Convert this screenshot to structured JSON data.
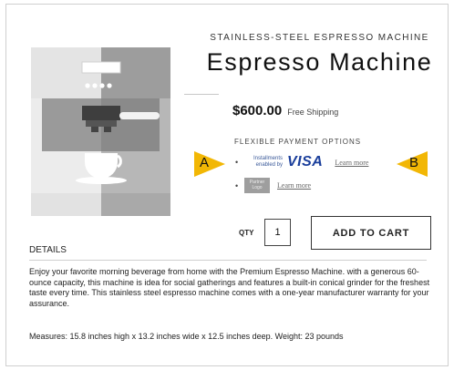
{
  "product": {
    "subtitle": "STAINLESS-STEEL ESPRESSO MACHINE",
    "title": "Espresso Machine",
    "price": "$600.00",
    "shipping": "Free Shipping"
  },
  "payment": {
    "heading": "FLEXIBLE PAYMENT OPTIONS",
    "installments_line1": "Installments",
    "installments_line2": "enabled by",
    "visa": "VISA",
    "learn_more_1": "Learn more",
    "partner_line1": "Partner",
    "partner_line2": "Logo",
    "learn_more_2": "Learn more"
  },
  "markers": {
    "a": "A",
    "b": "B",
    "color": "#f2b705"
  },
  "cart": {
    "qty_label": "QTY",
    "qty_value": "1",
    "add_label": "ADD TO CART"
  },
  "details": {
    "heading": "DETAILS",
    "body": "Enjoy your favorite morning beverage from home with the Premium Espresso Machine. with a generous 60-ounce capacity, this machine is idea for social gatherings and features a built-in conical grinder for the freshest taste every time. This stainless steel espresso machine comes with a one-year manufacturer warranty for your assurance.",
    "measures": "Measures: 15.8 inches high x 13.2 inches wide x 12.5 inches deep. Weight: 23 pounds"
  },
  "colors": {
    "visa": "#1a3e9b",
    "machine_light": "#e9e9e9",
    "machine_dark": "#b5b5b5"
  }
}
